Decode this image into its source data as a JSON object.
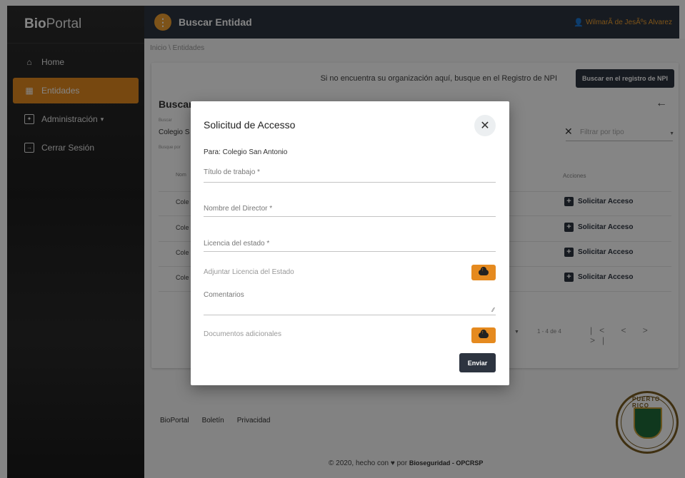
{
  "sidebar": {
    "brand_bold": "Bio",
    "brand_light": "Portal",
    "items": [
      {
        "label": "Home",
        "icon": "home-icon"
      },
      {
        "label": "Entidades",
        "icon": "entity-icon"
      },
      {
        "label": "Administración",
        "icon": "admin-icon"
      },
      {
        "label": "Cerrar Sesión",
        "icon": "logout-icon"
      }
    ],
    "dropdown_caret": "▾"
  },
  "topbar": {
    "menu_glyph": "⋮",
    "title": "Buscar Entidad",
    "user": "WilmarÃ de JesÃºs Alvarez"
  },
  "main": {
    "breadcrumb": "Inicio \\ Entidades",
    "npi_text": "Si no encuentra su organización aquí, busque en el Registro de NPI",
    "npi_button": "Buscar en el registro de NPI",
    "card_title": "Buscar",
    "search_label": "Buscar",
    "search_value": "Colegio S",
    "search_hint": "Busque por",
    "filter_placeholder": "Filtrar por tipo",
    "column_name": "Nom",
    "column_actions": "Acciones",
    "rows": [
      {
        "name": "Cole",
        "action": "Solicitar Acceso"
      },
      {
        "name": "Cole",
        "action": "Solicitar Acceso"
      },
      {
        "name": "Cole",
        "action": "Solicitar Acceso"
      },
      {
        "name": "Cole",
        "action": "Solicitar Acceso"
      }
    ],
    "paginator_range": "1 - 4 de 4",
    "paginator_nav": "|<  <  >  >|"
  },
  "footer": {
    "links": [
      "BioPortal",
      "Boletín",
      "Privacidad"
    ],
    "copy_prefix": "© 2020, hecho con",
    "copy_by": "por",
    "copy_org": "Bioseguridad - OPCRSP",
    "seal_text": "PUERTO RICO"
  },
  "modal": {
    "title": "Solicitud de Accesso",
    "close_glyph": "✕",
    "para": "Para: Colegio San Antonio",
    "fields": {
      "titulo": "Título de trabajo *",
      "director": "Nombre del Director *",
      "licencia": "Licencia del estado *",
      "adjuntar": "Adjuntar Licencia del Estado",
      "comentarios": "Comentarios",
      "documentos": "Documentos adicionales"
    },
    "submit": "Enviar"
  },
  "colors": {
    "accent": "#e58a1f",
    "dark": "#2d3440"
  }
}
